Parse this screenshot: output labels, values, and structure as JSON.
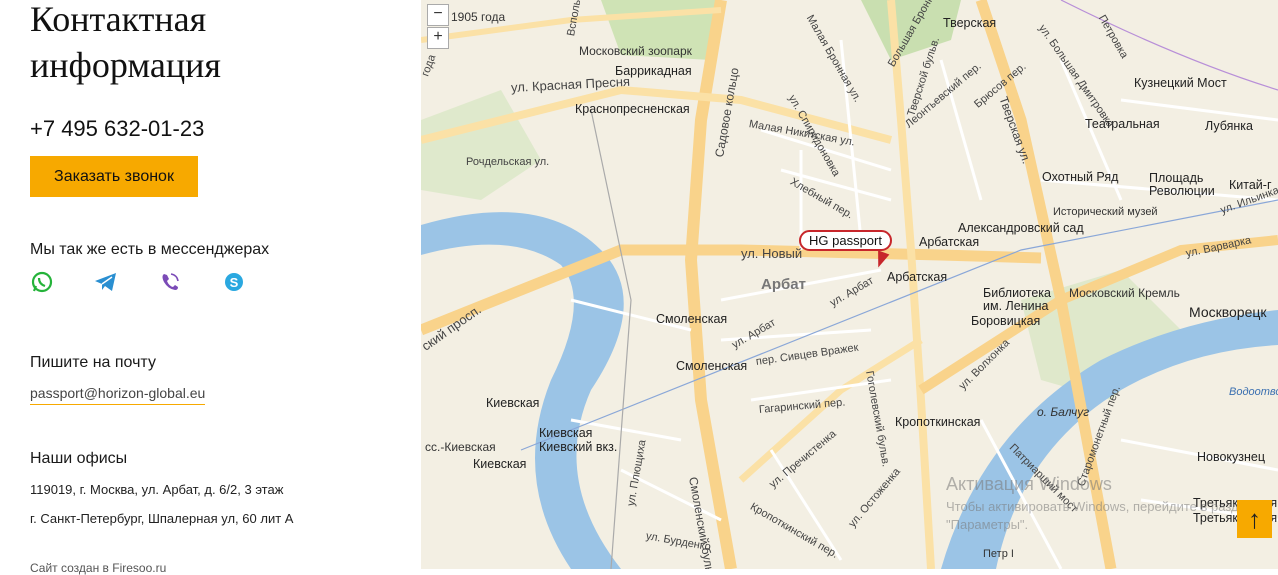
{
  "contact": {
    "title": "Контактная\nинформация",
    "phone": "+7 495 632-01-23",
    "call_button": "Заказать звонок",
    "messengers_title": "Мы так же есть в мессенджерах",
    "messengers": [
      "whatsapp-icon",
      "telegram-icon",
      "viber-icon",
      "skype-icon"
    ],
    "mail_title": "Пишите на почту",
    "email": "passport@horizon-global.eu",
    "offices_title": "Наши офисы",
    "offices": [
      "119019, г. Москва, ул. Арбат, д. 6/2, 3 этаж",
      "г. Санкт-Петербург, Шпалерная ул, 60 лит А"
    ],
    "footer": "Сайт создан в Firesoo.ru"
  },
  "map": {
    "zoom_out": "−",
    "zoom_in": "+",
    "marker_label": "HG passport",
    "labels": {
      "l1905": "1905 года",
      "zoo": "Московский зоопарк",
      "barrikadnaya": "Баррикадная",
      "krasnopresnenskaya": "Краснопресненская",
      "krasnaya_presnya": "ул. Красная Пресня",
      "rochdelskaya": "Рочдельская ул.",
      "novy_arbat": "ул. Новый",
      "arbat_area": "Арбат",
      "smolenskaya1": "Смоленская",
      "smolenskaya2": "Смоленская",
      "kievskaya1": "Киевская",
      "kievskaya2": "Киевская",
      "kievskaya3": "Киевская",
      "kiev_vkz": "Киевский вкз.",
      "ss_kievskaya": "сс.-Киевская",
      "arbatskaya1": "Арбатская",
      "arbatskaya2": "Арбатская",
      "alexandrovsky": "Александровский сад",
      "lenin_library": "Библиотека им. Ленина",
      "borovitskaya": "Боровицкая",
      "kremlin": "Московский Кремль",
      "tverskaya": "Тверская",
      "kuznetsky": "Кузнецкий Мост",
      "teatralnaya": "Театральная",
      "lubyanka": "Лубянка",
      "okhotny": "Охотный Ряд",
      "revolution": "Площадь Революции",
      "kitay": "Китай-г",
      "hist_museum": "Исторический музей",
      "moskvoretskaya": "Москворецк",
      "kropotkinskaya": "Кропоткинская",
      "balchug": "о. Балчуг",
      "novokuznetskaya": "Новокузнец",
      "tretyakovskaya1": "Третьяковская",
      "tretyakovskaya2": "Третьяковская",
      "petr": "Петр I",
      "varvarka": "ул. Варварка",
      "vodootvodny": "Водоотвод"
    },
    "streets": {
      "sadovoe": "Садовое кольцо",
      "smolensky": "Смоленский бульв.",
      "gogolevsky": "Гоголевский бульв.",
      "tverskoy": "Тверской бульв.",
      "tverskaya_ul": "Тверская ул.",
      "volkhonka": "ул. Волхонка",
      "prechistenka": "ул. Пречистенка",
      "ostozhenka": "ул. Остоженка",
      "spiridonovka": "ул. Спиридоновка",
      "malaya_nikitskaya": "Малая Никитская ул.",
      "khlebny": "Хлебный пер.",
      "gagarinsky": "Гагаринский пер.",
      "sivtsev": "пер. Сивцев Вражек",
      "arbat": "ул. Арбат",
      "arbat2": "ул. Арбат",
      "plyushchikha": "ул. Плющиха",
      "burdenko": "ул. Бурденко",
      "kropotkinsky": "Кропоткинский пер.",
      "kutuzovsky": "ский просп.",
      "patriarshy": "Патриарший мост",
      "leontevsky": "Леонтьевский пер.",
      "bryusov": "Брюсов пер.",
      "ilyinka": "ул. Ильинка",
      "bolshaya_dmitrovka": "ул. Большая Дмитровка",
      "bolshaya_bronnaya": "Большая Бронная ул.",
      "malaya_bronnaya": "Малая Бронная ул.",
      "petrovka": "Петровка",
      "vspolny": "Вспольный пер.",
      "staromonetny": "Старомонетный пер.",
      "goda": "года"
    },
    "watermark_title": "Активация Windows",
    "watermark_text": "Чтобы активировать Windows, перейдите в раздел \"Параметры\".",
    "scroll_top": "↑"
  }
}
